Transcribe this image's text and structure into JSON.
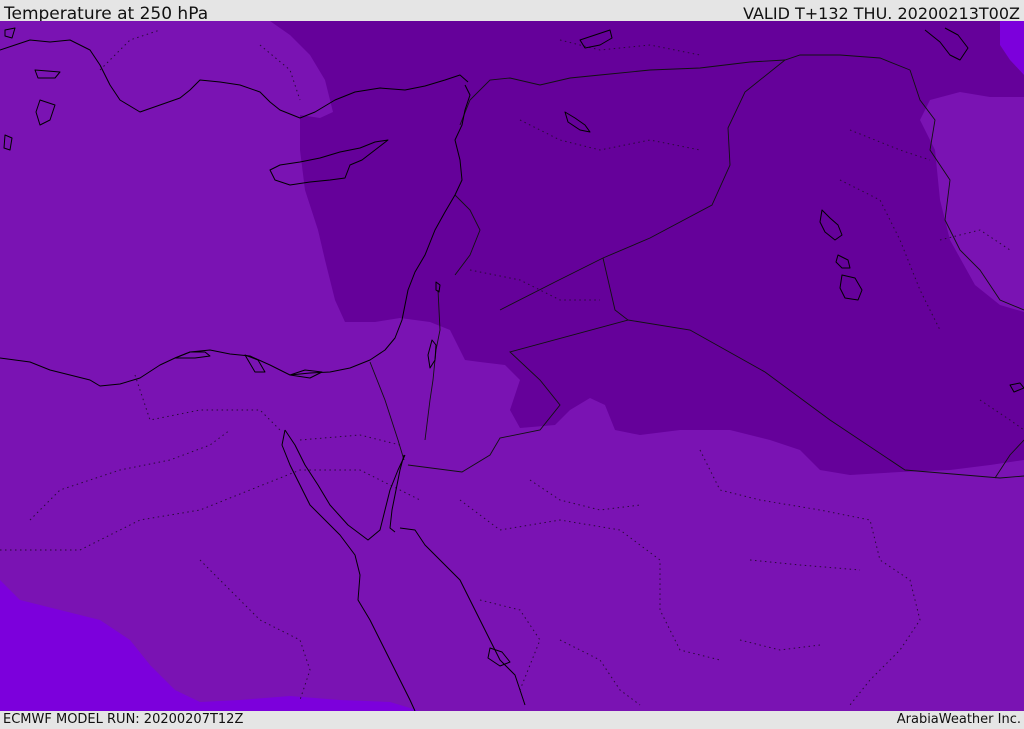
{
  "header": {
    "title": "Temperature at 250 hPa",
    "valid": "VALID T+132 THU. 20200213T00Z"
  },
  "footer": {
    "model_run": "ECMWF MODEL RUN: 20200207T12Z",
    "credit": "ArabiaWeather Inc."
  },
  "colors": {
    "background_band": "#7a13b3",
    "cold_band": "#65019a",
    "warm_band": "#7c00dc",
    "coastline": "#000000"
  }
}
